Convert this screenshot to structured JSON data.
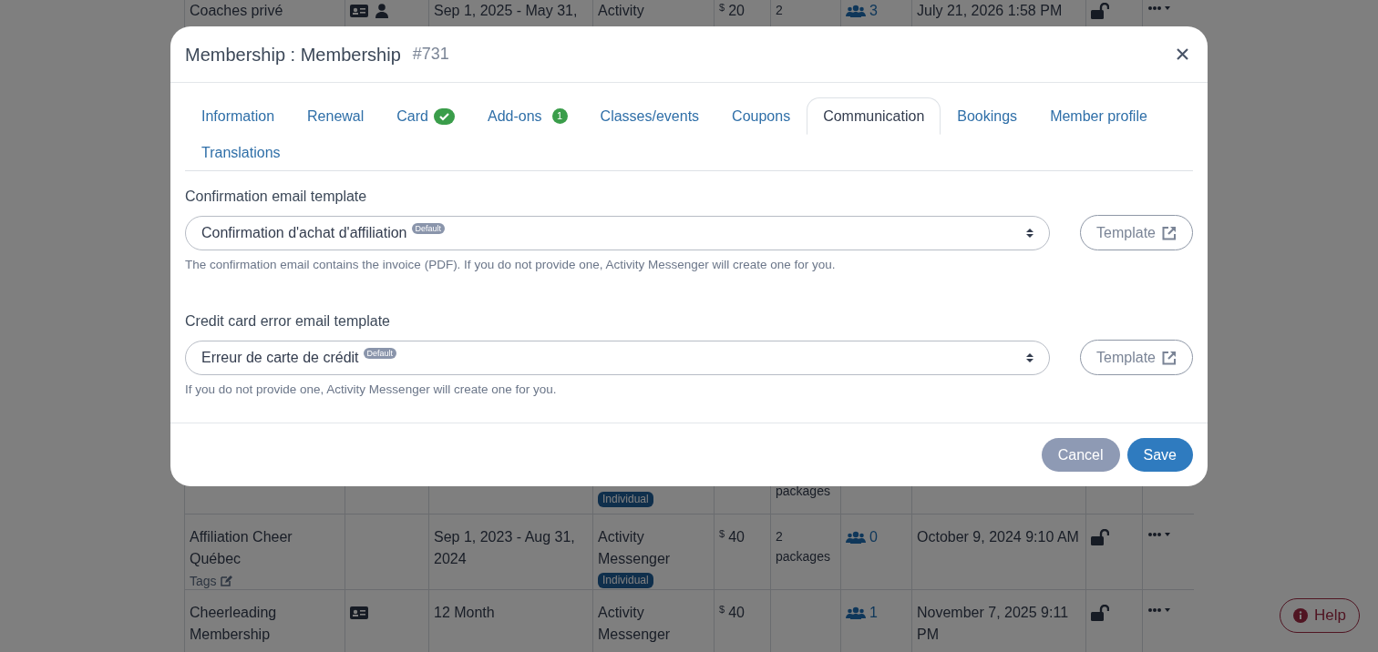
{
  "background_table": {
    "rows": [
      {
        "name": "Coaches privé",
        "icons": [
          {
            "kind": "card"
          },
          {
            "kind": "person"
          }
        ],
        "period": "Sep 1, 2025 - May 31,",
        "provider": "Activity",
        "currency": "$",
        "price": "20",
        "packages": "2",
        "members": "3",
        "date": "July 21, 2026 1:58 PM",
        "locked": false
      },
      {
        "badge": "Individual",
        "packages": "packages"
      },
      {
        "name": "Affiliation Cheer Québec",
        "tags": "Tags",
        "icons": [],
        "period": "Sep 1, 2023 - Aug 31, 2024",
        "provider": "Activity Messenger",
        "badge": "Individual",
        "currency": "$",
        "price": "40",
        "packages": "2 packages",
        "members": "0",
        "date": "October 9, 2024 9:10 AM",
        "locked": false
      },
      {
        "name": "Cheerleading Membership",
        "icons": [
          {
            "kind": "card"
          }
        ],
        "period": "12 Month",
        "provider": "Activity Messenger",
        "currency": "$",
        "price": "40",
        "members": "1",
        "date": "November 7, 2025 9:11 PM",
        "locked": false
      }
    ]
  },
  "modal": {
    "title": "Membership : Membership",
    "id": "#731",
    "tabs": [
      {
        "label": "Information",
        "selected": false
      },
      {
        "label": "Renewal",
        "selected": false
      },
      {
        "label": "Card",
        "selected": false,
        "badge": {
          "kind": "check"
        }
      },
      {
        "label": "Add-ons",
        "selected": false,
        "badge": {
          "kind": "count",
          "text": "1"
        }
      },
      {
        "label": "Classes/events",
        "selected": false
      },
      {
        "label": "Coupons",
        "selected": false
      },
      {
        "label": "Communication",
        "selected": true
      },
      {
        "label": "Bookings",
        "selected": false
      },
      {
        "label": "Member profile",
        "selected": false
      },
      {
        "label": "Translations",
        "selected": false
      }
    ],
    "fields": [
      {
        "label": "Confirmation email template",
        "value": "Confirmation d'achat d'affiliation",
        "tag": "Default",
        "help": "The confirmation email contains the invoice (PDF). If you do not provide one, Activity Messenger will create one for you.",
        "button": "Template"
      },
      {
        "label": "Credit card error email template",
        "value": "Erreur de carte de crédit",
        "tag": "Default",
        "help": "If you do not provide one, Activity Messenger will create one for you.",
        "button": "Template"
      }
    ],
    "buttons": [
      {
        "label": "Cancel",
        "kind": "secondary"
      },
      {
        "label": "Save",
        "kind": "primary"
      }
    ]
  },
  "help_button": "Help"
}
